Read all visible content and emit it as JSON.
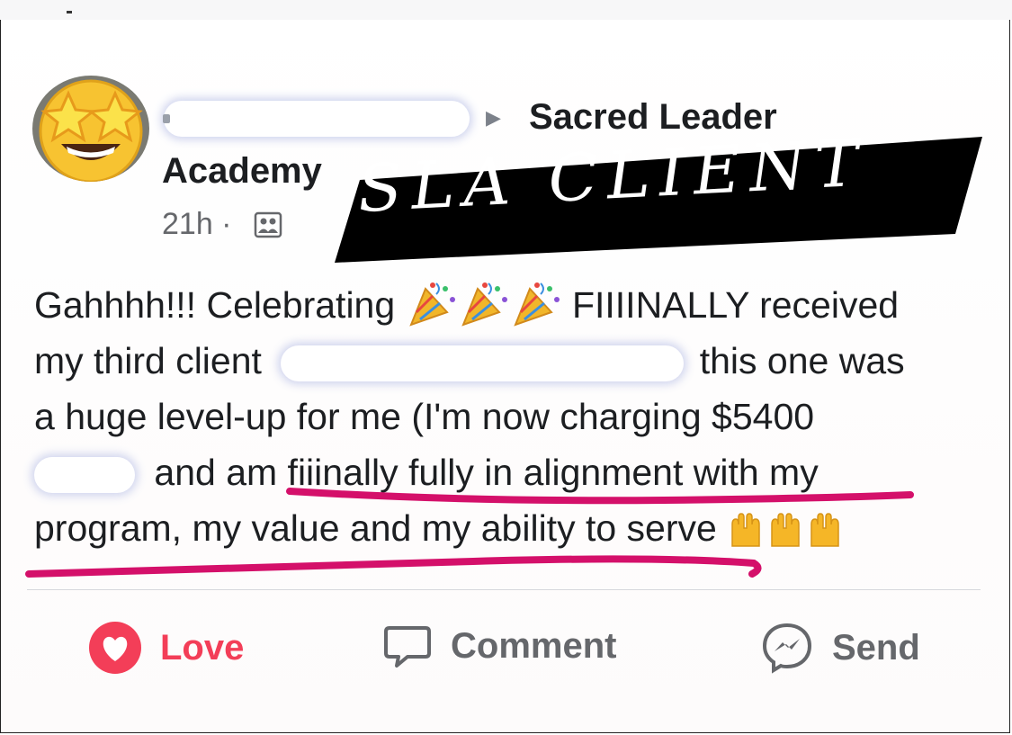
{
  "post": {
    "group_name_line1": "Sacred Leader",
    "group_name_line2": "Academy",
    "timestamp": "21h ·",
    "banner_text": "SLA CLIENT",
    "lines": {
      "l1_start": "Gahhhh!!! Celebrating",
      "l1_end": "FIIIINALLY received",
      "l2_start": "my third client",
      "l2_end": "this one was",
      "l3": "a huge level-up for me (I'm now charging $5400",
      "l4": "and am fiiinally fully in alignment with my",
      "l5": "program, my value and my ability to serve"
    }
  },
  "actions": {
    "love": "Love",
    "comment": "Comment",
    "send": "Send"
  },
  "colors": {
    "love": "#f33e58",
    "underline": "#d4106a",
    "muted": "#65676b",
    "banner_bg": "#000000"
  },
  "icons": {
    "avatar": "star-struck-emoji",
    "arrow": "triangle-right-icon",
    "audience": "group-audience-icon",
    "party": "party-popper-emoji",
    "hands": "raising-hands-emoji",
    "love": "heart-icon",
    "comment": "speech-bubble-icon",
    "send": "messenger-icon"
  }
}
